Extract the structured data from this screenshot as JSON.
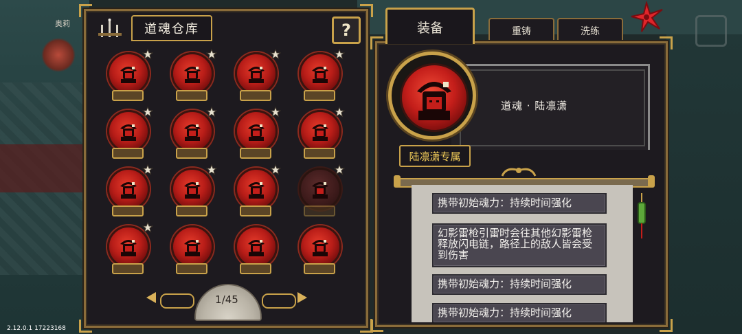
{
  "background": {
    "npc_name": "奥莉",
    "version": "2.12.0.1 17223168"
  },
  "warehouse": {
    "title": "道魂仓库",
    "help_label": "?",
    "items": [
      {
        "icon": "soul-orb-icon",
        "star": true,
        "dim": false
      },
      {
        "icon": "soul-orb-icon",
        "star": true,
        "dim": false
      },
      {
        "icon": "soul-orb-icon",
        "star": true,
        "dim": false
      },
      {
        "icon": "soul-orb-icon",
        "star": true,
        "dim": false
      },
      {
        "icon": "soul-orb-icon",
        "star": true,
        "dim": false
      },
      {
        "icon": "soul-orb-icon",
        "star": true,
        "dim": false
      },
      {
        "icon": "soul-orb-icon",
        "star": true,
        "dim": false
      },
      {
        "icon": "soul-orb-icon",
        "star": true,
        "dim": false
      },
      {
        "icon": "soul-orb-icon",
        "star": true,
        "dim": false
      },
      {
        "icon": "soul-orb-icon",
        "star": true,
        "dim": false
      },
      {
        "icon": "soul-orb-icon",
        "star": true,
        "dim": false
      },
      {
        "icon": "soul-orb-icon",
        "star": true,
        "dim": true
      },
      {
        "icon": "soul-orb-icon",
        "star": true,
        "dim": false
      },
      {
        "icon": "soul-orb-icon",
        "star": false,
        "dim": false
      },
      {
        "icon": "soul-orb-icon",
        "star": false,
        "dim": false
      },
      {
        "icon": "soul-orb-icon",
        "star": false,
        "dim": false
      }
    ],
    "page_label": "1/45"
  },
  "tabs": {
    "equip": "装备",
    "recast": "重铸",
    "refine": "洗练"
  },
  "detail": {
    "name": "道魂 · 陆凛潇",
    "exclusive_label": "陆凛潇专属",
    "effects": [
      "携带初始魂力：持续时间强化",
      "幻影雷枪引雷时会往其他幻影雷枪释放闪电链，路径上的敌人皆会受到伤害",
      "携带初始魂力：持续时间强化",
      "携带初始魂力：持续时间强化"
    ]
  },
  "colors": {
    "gold": "#c9a24a",
    "orb_red": "#c41e1a",
    "panel_bg": "#1d1a1f",
    "effect_bg": "#4a4650",
    "exclusive_text": "#f5cf5a"
  }
}
